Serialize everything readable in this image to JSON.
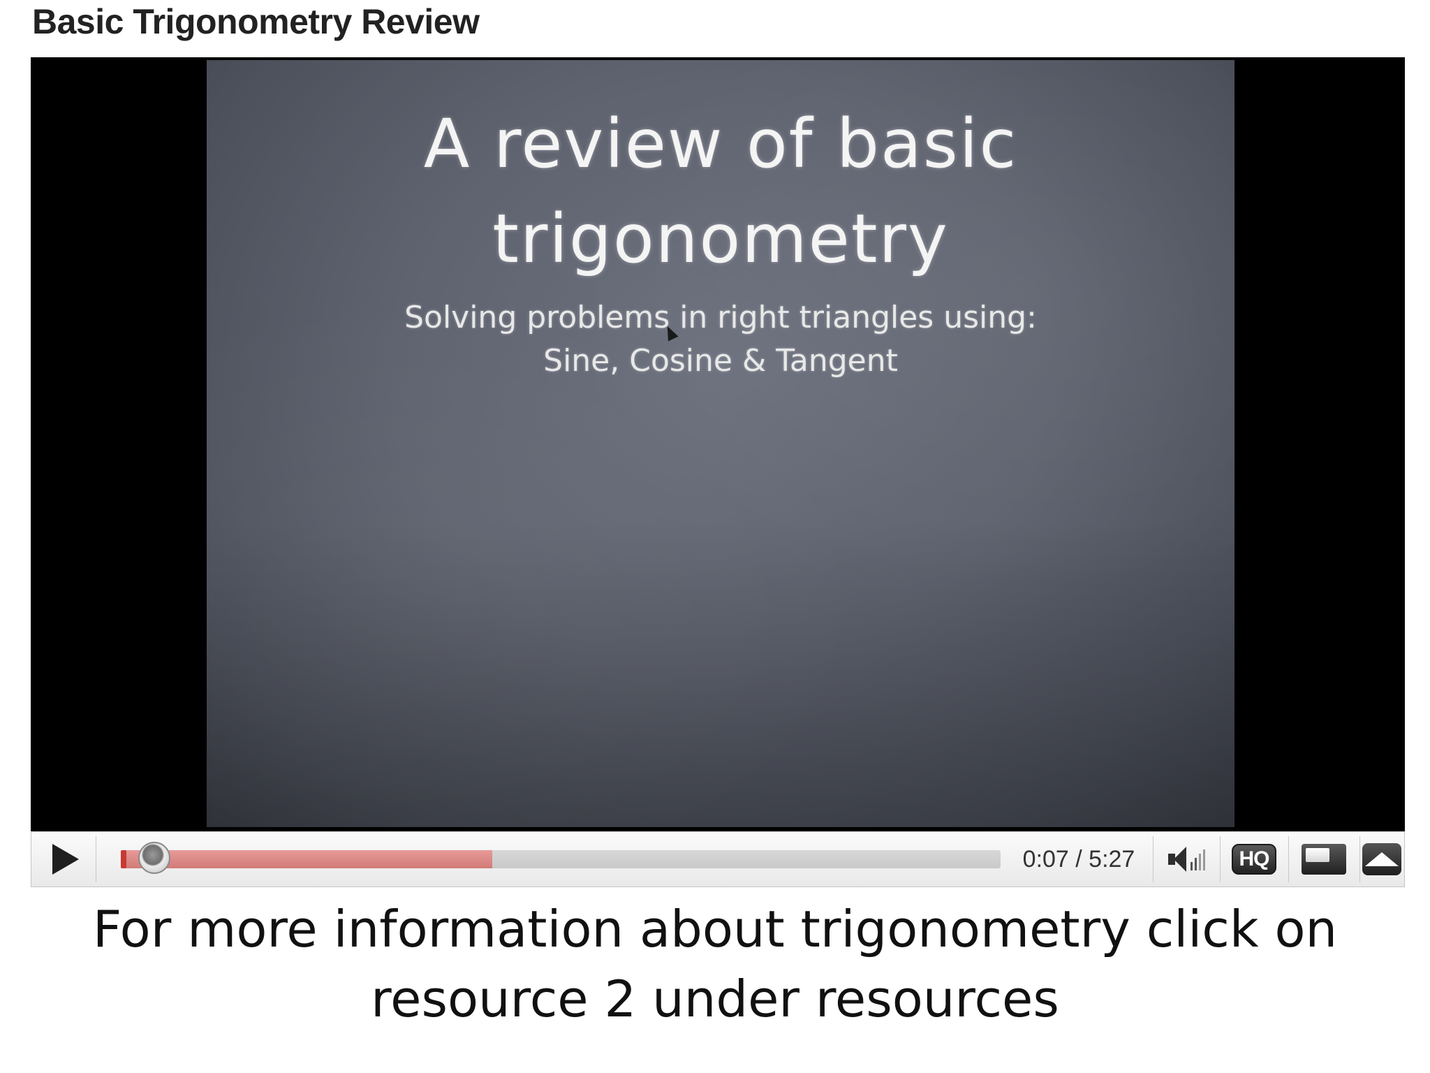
{
  "page": {
    "title": "Basic Trigonometry Review"
  },
  "slide": {
    "title_line1": "A review of basic",
    "title_line2": "trigonometry",
    "subtitle_line1": "Solving problems in right triangles using:",
    "subtitle_line2": "Sine, Cosine & Tangent"
  },
  "player": {
    "time_display": "0:07 / 5:27",
    "buffered_fraction": 0.42,
    "played_fraction": 0.02,
    "hq_label": "HQ",
    "icons": {
      "play": "play-icon",
      "volume": "volume-icon",
      "hq": "hq-icon",
      "popout": "popout-icon",
      "fullscreen": "fullscreen-icon"
    }
  },
  "caption": {
    "line1": "For more information about trigonometry click on",
    "line2": "resource 2 under resources"
  }
}
